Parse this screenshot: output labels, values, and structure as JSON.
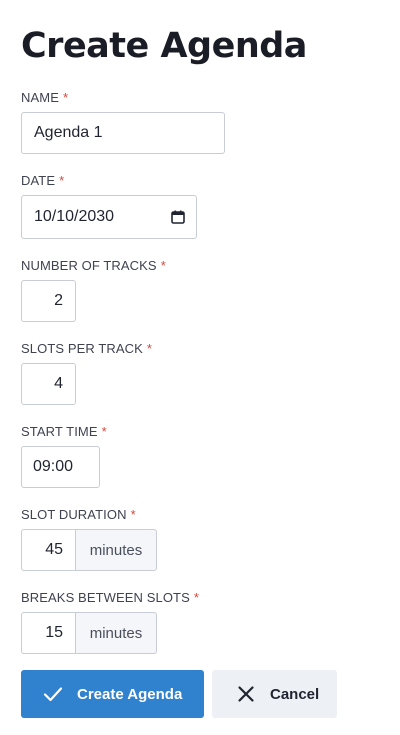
{
  "page": {
    "title": "Create Agenda"
  },
  "form": {
    "required_marker": "*",
    "name": {
      "label": "NAME",
      "value": "Agenda 1"
    },
    "date": {
      "label": "DATE",
      "value": "10/10/2030"
    },
    "tracks": {
      "label": "NUMBER OF TRACKS",
      "value": "2"
    },
    "slots": {
      "label": "SLOTS PER TRACK",
      "value": "4"
    },
    "start_time": {
      "label": "START TIME",
      "value": "09:00"
    },
    "slot_duration": {
      "label": "SLOT DURATION",
      "value": "45",
      "unit": "minutes"
    },
    "breaks": {
      "label": "BREAKS BETWEEN SLOTS",
      "value": "15",
      "unit": "minutes"
    }
  },
  "actions": {
    "submit_label": "Create Agenda",
    "cancel_label": "Cancel"
  },
  "colors": {
    "primary": "#3182ce",
    "required": "#d9453a",
    "secondary_bg": "#edf0f4"
  },
  "icons": {
    "submit": "check-icon",
    "cancel": "close-icon",
    "date": "calendar-icon"
  }
}
